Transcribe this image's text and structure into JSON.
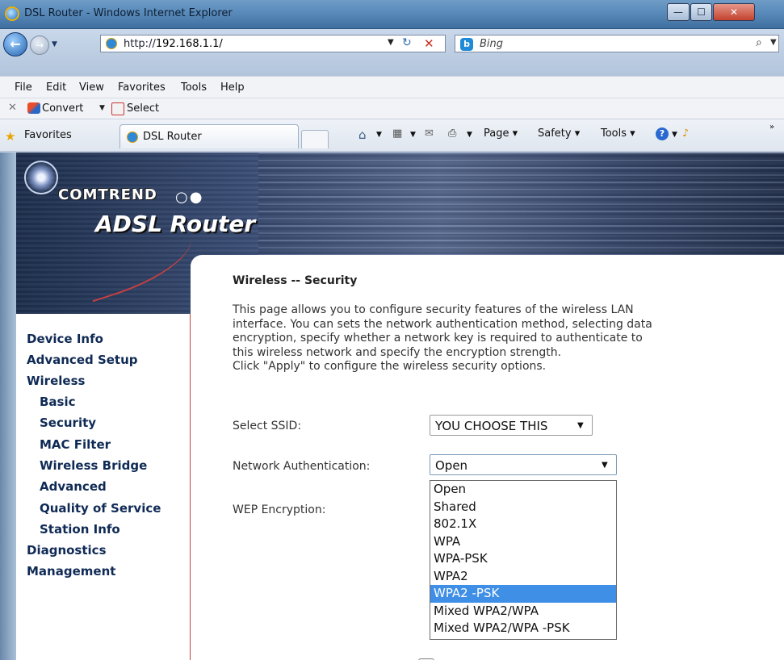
{
  "window": {
    "title": "DSL Router - Windows Internet Explorer",
    "min_glyph": "—",
    "max_glyph": "☐",
    "close_glyph": "✕"
  },
  "address": {
    "prefix": "http://",
    "host": "192.168.1.1/",
    "back_glyph": "←",
    "forward_glyph": "→",
    "refresh_glyph": "↻",
    "stop_glyph": "✕"
  },
  "search": {
    "engine": "Bing",
    "icon_glyph": "⌕",
    "logo_glyph": "b"
  },
  "menu": [
    "File",
    "Edit",
    "View",
    "Favorites",
    "Tools",
    "Help"
  ],
  "command_bar": {
    "close_glyph": "✕",
    "convert_label": "Convert",
    "select_label": "Select"
  },
  "favorites_bar": {
    "favorites_label": "Favorites",
    "tab_label": "DSL Router",
    "page_menu": "Page ▾",
    "safety_menu": "Safety ▾",
    "tools_menu": "Tools ▾",
    "home_glyph": "⌂",
    "feeds_glyph": "▦",
    "mail_glyph": "✉",
    "print_glyph": "⎙",
    "help_glyph": "?",
    "more_glyph": "»"
  },
  "banner": {
    "brand": "COMTREND",
    "brand_suffix": "○●",
    "product": "ADSL Router"
  },
  "sidebar": {
    "items": [
      {
        "label": "Device Info"
      },
      {
        "label": "Advanced Setup"
      },
      {
        "label": "Wireless"
      },
      {
        "label": "Basic"
      },
      {
        "label": "Security"
      },
      {
        "label": "MAC Filter"
      },
      {
        "label": "Wireless Bridge"
      },
      {
        "label": "Advanced"
      },
      {
        "label": "Quality of Service"
      },
      {
        "label": "Station Info"
      },
      {
        "label": "Diagnostics"
      },
      {
        "label": "Management"
      }
    ]
  },
  "content": {
    "heading": "Wireless -- Security",
    "description_lines": [
      "This page allows you to configure security features of the wireless LAN",
      "interface. You can sets the network authentication method, selecting data",
      "encryption, specify whether a network key is required to authenticate to",
      "this wireless network and specify the encryption strength.",
      "Click \"Apply\" to configure the wireless security options."
    ],
    "ssid_label": "Select SSID:",
    "ssid_value": "YOU CHOOSE THIS",
    "auth_label": "Network Authentication:",
    "auth_value": "Open",
    "wep_label": "WEP Encryption:",
    "auth_options": [
      "Open",
      "Shared",
      "802.1X",
      "WPA",
      "WPA-PSK",
      "WPA2",
      "WPA2 -PSK",
      "Mixed WPA2/WPA",
      "Mixed WPA2/WPA -PSK"
    ],
    "highlighted_option": "WPA2 -PSK"
  }
}
